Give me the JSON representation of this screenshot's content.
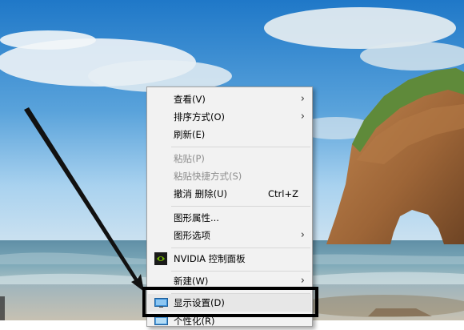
{
  "menu": {
    "items": [
      {
        "label": "查看(V)",
        "submenu": true
      },
      {
        "label": "排序方式(O)",
        "submenu": true
      },
      {
        "label": "刷新(E)"
      },
      {
        "label": "粘贴(P)",
        "disabled": true
      },
      {
        "label": "粘贴快捷方式(S)",
        "disabled": true
      },
      {
        "label": "撤消 删除(U)",
        "shortcut": "Ctrl+Z"
      },
      {
        "label": "图形属性..."
      },
      {
        "label": "图形选项",
        "submenu": true
      },
      {
        "label": "NVIDIA 控制面板",
        "icon": "nvidia-icon"
      },
      {
        "label": "新建(W)",
        "submenu": true
      },
      {
        "label": "显示设置(D)",
        "icon": "display-icon",
        "highlighted": true
      },
      {
        "label": "个性化(R)",
        "icon": "personalize-icon"
      }
    ],
    "submenu_arrow": "›"
  },
  "annotation": {
    "arrow_color": "#111111",
    "box_color": "#000000"
  },
  "colors": {
    "menu_bg": "#f2f2f2",
    "highlight": "#e7e7e7",
    "nvidia_green": "#76b900"
  }
}
